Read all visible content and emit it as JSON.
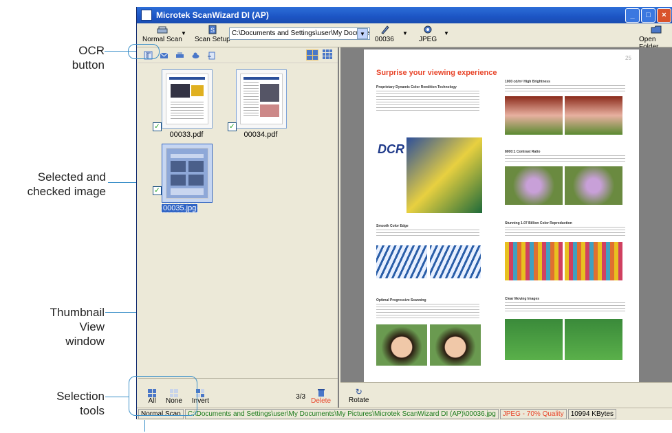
{
  "callouts": {
    "ocr": "OCR\nbutton",
    "selected": "Selected and\nchecked image",
    "thumbview": "Thumbnail\nView\nwindow",
    "selection": "Selection\ntools"
  },
  "window": {
    "title": "Microtek ScanWizard DI (AP)"
  },
  "toolbar": {
    "normal_scan": "Normal Scan",
    "scan_setup": "Scan Setup",
    "path": "C:\\Documents and Settings\\user\\My Documents\\",
    "counter": "00036",
    "format": "JPEG",
    "open_folder": "Open Folder"
  },
  "thumbnails": [
    {
      "name": "00033.pdf",
      "checked": true,
      "selected": false
    },
    {
      "name": "00034.pdf",
      "checked": true,
      "selected": false
    },
    {
      "name": "00035.jpg",
      "checked": true,
      "selected": true
    }
  ],
  "bottom_tools": {
    "all": "All",
    "none": "None",
    "invert": "Invert",
    "count": "3/3",
    "delete": "Delete",
    "rotate": "Rotate"
  },
  "preview": {
    "headline": "Surprise your viewing experience",
    "logo_text": "DCR",
    "section_titles": [
      "Proprietary Dynamic Color Rendition Technology",
      "1000 cd/m² High Brightness",
      "8000:1 Contrast Ratio",
      "Smooth Color Edge",
      "Stunning 1.07 Billion Color Reproduction",
      "Optimal Progressive Scanning",
      "Clear Moving Images"
    ]
  },
  "statusbar": {
    "mode": "Normal Scan",
    "file": "C:\\Documents and Settings\\user\\My Documents\\My Pictures\\Microtek ScanWizard DI (AP)\\00036.jpg",
    "quality": "JPEG - 70% Quality",
    "size": "10994 KBytes"
  },
  "colors": {
    "accent": "#1c54c4",
    "callout_line": "#3a8fc8",
    "headline": "#e8452a",
    "quality_text": "#e8452a",
    "file_text": "#1a7a1a"
  }
}
